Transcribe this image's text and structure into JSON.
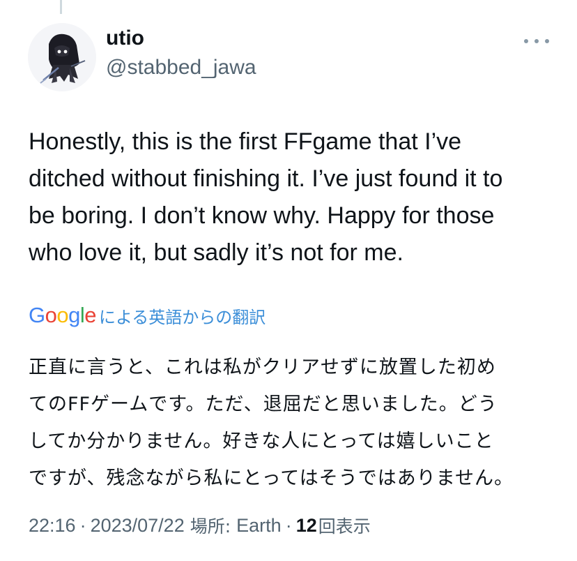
{
  "tweet": {
    "author": {
      "display_name": "utio",
      "handle": "@stabbed_jawa"
    },
    "text_lines": [
      "Honestly, this is the first FFgame that I’ve",
      "ditched without finishing it. I’ve just found it to",
      "be boring. I don’t know why. Happy for those",
      "who love it, but sadly it’s not for me."
    ],
    "translation": {
      "provider_logo_text": "Google",
      "label": "による英語からの翻訳",
      "text_lines": [
        "正直に言うと、これは私がクリアせずに放置した初め",
        "てのFFゲームです。ただ、退屈だと思いました。どう",
        "してか分かりません。好きな人にとっては嬉しいこと",
        "ですが、残念ながら私にとってはそうではありません。"
      ]
    },
    "meta": {
      "time": "22:16",
      "date": "2023/07/22",
      "location_label": "場所:",
      "location": "Earth",
      "views_count": "12",
      "views_label": "回表示"
    }
  },
  "icons": {
    "more": "more-horizontal-icon"
  },
  "colors": {
    "text_primary": "#0f1419",
    "text_secondary": "#536471",
    "link_blue": "#3b8ed8",
    "thread_line": "#cfd9de"
  }
}
